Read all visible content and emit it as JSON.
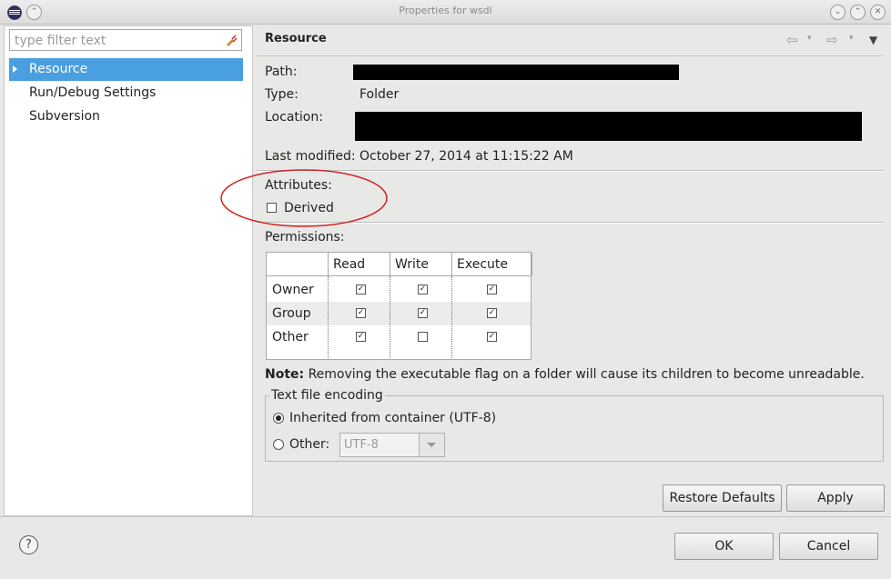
{
  "window": {
    "title": "Properties for wsdl"
  },
  "filter": {
    "placeholder": "type filter text"
  },
  "tree": {
    "items": [
      {
        "label": "Resource",
        "selected": true
      },
      {
        "label": "Run/Debug Settings",
        "selected": false
      },
      {
        "label": "Subversion",
        "selected": false
      }
    ]
  },
  "page": {
    "title": "Resource",
    "path_label": "Path:",
    "type_label": "Type:",
    "type_value": "Folder",
    "location_label": "Location:",
    "modified_label": "Last modified:",
    "modified_value": "October 27, 2014 at 11:15:22 AM",
    "attributes_label": "Attributes:",
    "derived_label": "Derived",
    "derived_checked": false,
    "permissions_label": "Permissions:"
  },
  "permissions": {
    "headers": [
      "",
      "Read",
      "Write",
      "Execute"
    ],
    "rows": [
      {
        "label": "Owner",
        "read": true,
        "write": true,
        "execute": true
      },
      {
        "label": "Group",
        "read": true,
        "write": true,
        "execute": true
      },
      {
        "label": "Other",
        "read": true,
        "write": false,
        "execute": true
      }
    ]
  },
  "note": {
    "bold": "Note:",
    "text": "Removing the executable flag on a folder will cause its children to become unreadable."
  },
  "encoding": {
    "group_label": "Text file encoding",
    "inherited_label": "Inherited from container (UTF-8)",
    "other_label": "Other:",
    "other_value": "UTF-8",
    "selected": "inherited"
  },
  "buttons": {
    "restore_defaults": "Restore Defaults",
    "apply": "Apply",
    "ok": "OK",
    "cancel": "Cancel",
    "help": "?"
  },
  "colors": {
    "selection": "#4a9fe0",
    "annotation_circle": "#d21f1f"
  }
}
